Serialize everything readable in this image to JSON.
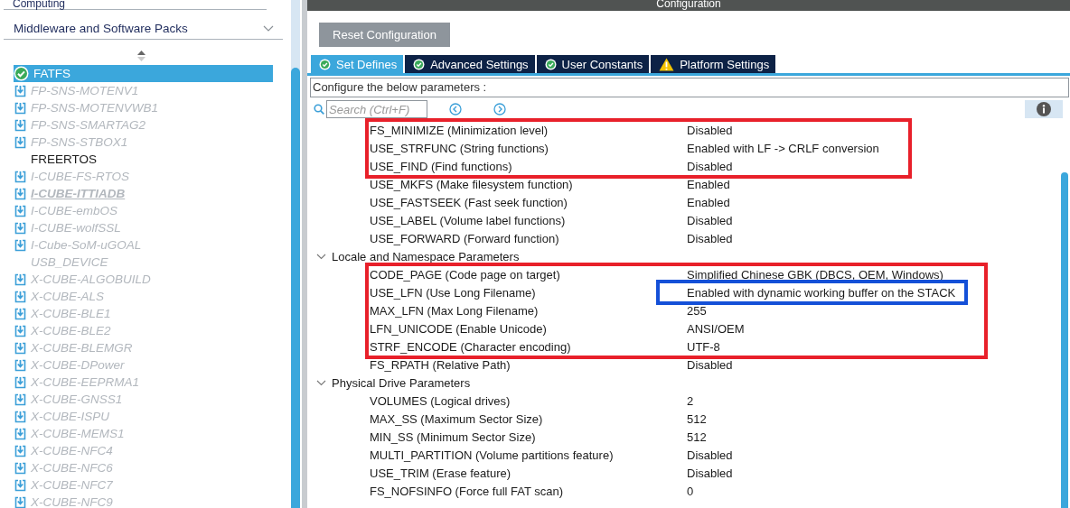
{
  "sidebar": {
    "top_category": "Computing",
    "category": {
      "label": "Middleware and Software Packs",
      "expanded": true
    },
    "items": [
      {
        "label": "FATFS",
        "kind": "active",
        "selected": true
      },
      {
        "label": "FP-SNS-MOTENV1",
        "kind": "pack",
        "selected": false
      },
      {
        "label": "FP-SNS-MOTENVWB1",
        "kind": "pack",
        "selected": false
      },
      {
        "label": "FP-SNS-SMARTAG2",
        "kind": "pack",
        "selected": false
      },
      {
        "label": "FP-SNS-STBOX1",
        "kind": "pack",
        "selected": false
      },
      {
        "label": "FREERTOS",
        "kind": "plain",
        "selected": false
      },
      {
        "label": "I-CUBE-FS-RTOS",
        "kind": "pack",
        "selected": false
      },
      {
        "label": "I-CUBE-ITTIADB",
        "kind": "pack-link",
        "selected": false
      },
      {
        "label": "I-CUBE-embOS",
        "kind": "pack",
        "selected": false
      },
      {
        "label": "I-CUBE-wolfSSL",
        "kind": "pack",
        "selected": false
      },
      {
        "label": "I-Cube-SoM-uGOAL",
        "kind": "pack",
        "selected": false
      },
      {
        "label": "USB_DEVICE",
        "kind": "unavailable",
        "selected": false
      },
      {
        "label": "X-CUBE-ALGOBUILD",
        "kind": "pack",
        "selected": false
      },
      {
        "label": "X-CUBE-ALS",
        "kind": "pack",
        "selected": false
      },
      {
        "label": "X-CUBE-BLE1",
        "kind": "pack",
        "selected": false
      },
      {
        "label": "X-CUBE-BLE2",
        "kind": "pack",
        "selected": false
      },
      {
        "label": "X-CUBE-BLEMGR",
        "kind": "pack",
        "selected": false
      },
      {
        "label": "X-CUBE-DPower",
        "kind": "pack",
        "selected": false
      },
      {
        "label": "X-CUBE-EEPRMA1",
        "kind": "pack",
        "selected": false
      },
      {
        "label": "X-CUBE-GNSS1",
        "kind": "pack",
        "selected": false
      },
      {
        "label": "X-CUBE-ISPU",
        "kind": "pack",
        "selected": false
      },
      {
        "label": "X-CUBE-MEMS1",
        "kind": "pack",
        "selected": false
      },
      {
        "label": "X-CUBE-NFC4",
        "kind": "pack",
        "selected": false
      },
      {
        "label": "X-CUBE-NFC6",
        "kind": "pack",
        "selected": false
      },
      {
        "label": "X-CUBE-NFC7",
        "kind": "pack",
        "selected": false
      },
      {
        "label": "X-CUBE-NFC9",
        "kind": "pack",
        "selected": false
      }
    ]
  },
  "config": {
    "title": "Configuration",
    "reset_button": "Reset Configuration",
    "tabs": [
      {
        "label": "Set Defines",
        "kind": "ok",
        "selected": true
      },
      {
        "label": "Advanced Settings",
        "kind": "ok",
        "selected": false
      },
      {
        "label": "User Constants",
        "kind": "ok",
        "selected": false
      },
      {
        "label": "Platform Settings",
        "kind": "warning",
        "selected": false
      }
    ],
    "description": "Configure the below parameters :",
    "search": {
      "placeholder": "Search (Ctrl+F)"
    },
    "groups": [
      {
        "params": [
          {
            "name": "FS_MINIMIZE (Minimization level)",
            "value": "Disabled",
            "color": "#e8202a"
          },
          {
            "name": "USE_STRFUNC (String functions)",
            "value": "Enabled with LF -> CRLF conversion",
            "color": "#e8202a"
          },
          {
            "name": "USE_FIND (Find functions)",
            "value": "Disabled",
            "color": "#e8202a"
          },
          {
            "name": "USE_MKFS (Make filesystem function)",
            "value": "Enabled"
          },
          {
            "name": "USE_FASTSEEK (Fast seek function)",
            "value": "Enabled"
          },
          {
            "name": "USE_LABEL (Volume label functions)",
            "value": "Disabled"
          },
          {
            "name": "USE_FORWARD (Forward function)",
            "value": "Disabled"
          }
        ]
      },
      {
        "title": "Locale and Namespace Parameters",
        "expanded": true,
        "params": [
          {
            "name": "CODE_PAGE (Code page on target)",
            "value": "Simplified Chinese GBK (DBCS, OEM, Windows)",
            "color": "#e8202a"
          },
          {
            "name": "USE_LFN (Use Long Filename)",
            "value": "Enabled with dynamic working buffer on the STACK",
            "color": "#e8202a",
            "value_frame": {
              "color": "#1450d8"
            }
          },
          {
            "name": "MAX_LFN (Max Long Filename)",
            "value": "255",
            "color": "#e8202a"
          },
          {
            "name": "LFN_UNICODE (Enable Unicode)",
            "value": "ANSI/OEM",
            "color": "#e8202a"
          },
          {
            "name": "STRF_ENCODE (Character encoding)",
            "value": "UTF-8",
            "color": "#e8202a"
          },
          {
            "name": "FS_RPATH (Relative Path)",
            "value": "Disabled"
          }
        ]
      },
      {
        "title": "Physical Drive Parameters",
        "expanded": true,
        "params": [
          {
            "name": "VOLUMES (Logical drives)",
            "value": "2"
          },
          {
            "name": "MAX_SS (Maximum Sector Size)",
            "value": "512"
          },
          {
            "name": "MIN_SS (Minimum Sector Size)",
            "value": "512"
          },
          {
            "name": "MULTI_PARTITION (Volume partitions feature)",
            "value": "Disabled"
          },
          {
            "name": "USE_TRIM (Erase feature)",
            "value": "Disabled"
          },
          {
            "name": "FS_NOFSINFO (Force full FAT scan)",
            "value": "0"
          }
        ]
      }
    ]
  }
}
